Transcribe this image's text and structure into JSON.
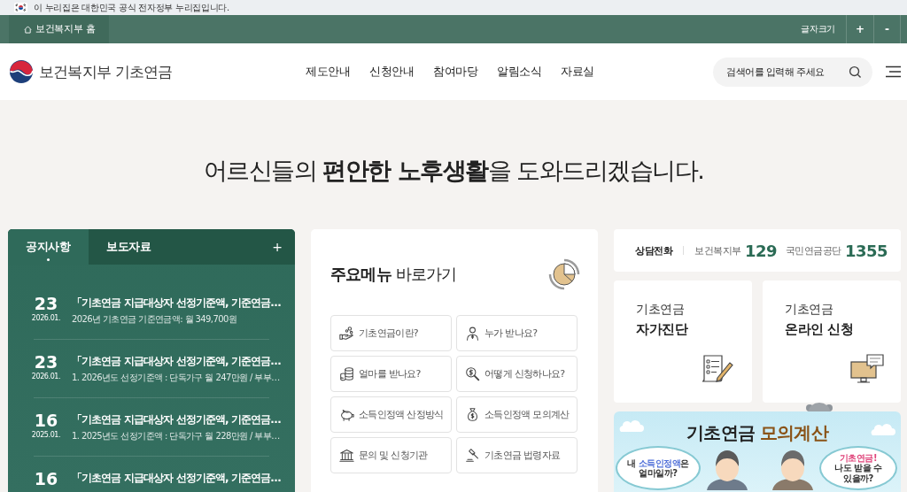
{
  "gov_banner": {
    "text": "이 누리집은 대한민국 공식 전자정부 누리집입니다."
  },
  "utility_bar": {
    "home_link": "보건복지부 홈",
    "font_size_label": "글자크기",
    "font_size_buttons": [
      "+",
      "-"
    ]
  },
  "header": {
    "site_title": "보건복지부 기초연금",
    "nav": [
      "제도안내",
      "신청안내",
      "참여마당",
      "알림소식",
      "자료실"
    ],
    "search": {
      "placeholder": "검색어를 입력해 주세요"
    }
  },
  "hero": {
    "heading": "어르신들의 **편안한 노후생활**을 도와드리겠습니다."
  },
  "notice_panel": {
    "tabs": [
      {
        "label": "공지사항",
        "selected": true
      },
      {
        "label": "보도자료",
        "selected": false
      }
    ],
    "more": "+",
    "items": [
      {
        "day": "23",
        "month": "2026.01.",
        "title": "「기초연금 지급대상자 선정기준액, 기준연금…",
        "summary": "2026년 기초연금 기준연금액: 월 349,700원"
      },
      {
        "day": "23",
        "month": "2026.01.",
        "title": "「기초연금 지급대상자 선정기준액, 기준연금…",
        "summary": "1. 2026년도 선정기준액 : 단독가구 월 247만원 / 부부…"
      },
      {
        "day": "16",
        "month": "2025.01.",
        "title": "「기초연금 지급대상자 선정기준액, 기준연금…",
        "summary": "1. 2025년도 선정기준액 : 단독가구 월 228만원 / 부부…"
      },
      {
        "day": "16",
        "title": "「기초연금 지급대상자 선정기준액, 기준연금…"
      }
    ]
  },
  "quick_menu": {
    "title": "**주요메뉴** 바로가기",
    "items": [
      "기초연금이란?",
      "누가 받나요?",
      "얼마를 받나요?",
      "어떻게 신청하나요?",
      "소득인정액 산정방식",
      "소득인정액 모의계산",
      "문의 및 신청기관",
      "기초연금 법령자료"
    ]
  },
  "contact": {
    "label": "상담전화",
    "numbers": [
      {
        "name": "보건복지부",
        "number": "129"
      },
      {
        "name": "국민연금공단",
        "number": "1355"
      }
    ]
  },
  "service_cards": [
    {
      "line1": "기초연금",
      "line2": "자가진단"
    },
    {
      "line1": "기초연금",
      "line2": "온라인 신청"
    }
  ],
  "banner": {
    "title": [
      {
        "text": "기초연금 ",
        "highlight": false
      },
      {
        "text": "모의계산",
        "highlight": true
      }
    ],
    "bubbles": [
      {
        "color": "#4f6fd8",
        "lines": [
          [
            {
              "text": "내 ",
              "highlight": false
            },
            {
              "text": "소득인정액",
              "highlight": true
            },
            {
              "text": "은",
              "highlight": false
            }
          ],
          [
            {
              "text": "얼마일까?",
              "highlight": false
            }
          ]
        ]
      },
      {
        "color": "#e0457b",
        "lines": [
          [
            {
              "text": "기초연금!",
              "highlight": true
            }
          ],
          [
            {
              "text": "나도 받을 수",
              "highlight": false
            }
          ],
          [
            {
              "text": "있을까?",
              "highlight": false
            }
          ]
        ]
      }
    ]
  }
}
